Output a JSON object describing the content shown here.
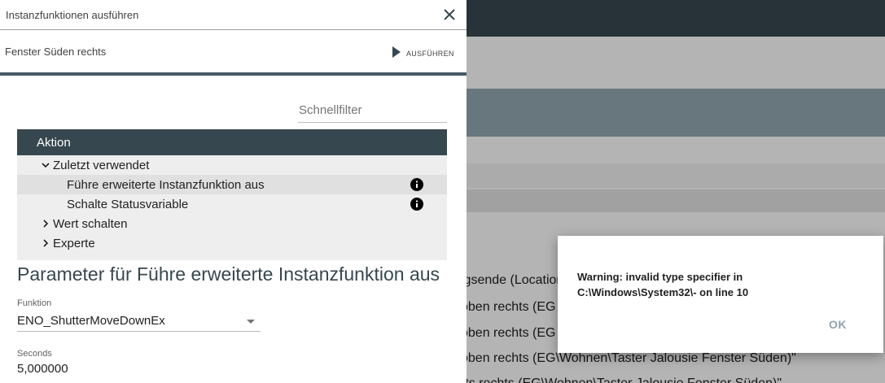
{
  "background": {
    "lines": [
      "igsende (Location",
      "oben rechts (EG",
      "oben rechts (EG",
      "oben rechts (EG\\Wohnen\\Taster Jalousie Fenster Süden)\"",
      "rts rechts (EG\\Wohnen\\Taster Jalousie Fenster Süden)\""
    ]
  },
  "dialog": {
    "title": "Instanzfunktionen ausführen",
    "close_icon": "close-icon",
    "instance_name": "Fenster Süden rechts",
    "run_label": "AUSFÜHREN",
    "filter_placeholder": "Schnellfilter",
    "tree": {
      "header": "Aktion",
      "items": [
        {
          "label": "Zuletzt verwendet",
          "type": "group",
          "expanded": true
        },
        {
          "label": "Führe erweiterte Instanzfunktion aus",
          "type": "leaf",
          "selected": true,
          "info": true
        },
        {
          "label": "Schalte Statusvariable",
          "type": "leaf",
          "selected": false,
          "info": true
        },
        {
          "label": "Wert schalten",
          "type": "group",
          "expanded": false
        },
        {
          "label": "Experte",
          "type": "group",
          "expanded": false
        }
      ]
    },
    "params_title": "Parameter für Führe erweiterte Instanzfunktion aus",
    "function_label": "Funktion",
    "function_value": "ENO_ShutterMoveDownEx",
    "seconds_label": "Seconds",
    "seconds_value": "5,000000"
  },
  "warning": {
    "message_line1": "Warning: invalid type specifier in",
    "message_line2": "C:\\Windows\\System32\\- on line 10",
    "ok_label": "OK"
  },
  "colors": {
    "header_dark": "#37474f",
    "accent": "#455a64",
    "ok_text": "#90a4ae"
  }
}
